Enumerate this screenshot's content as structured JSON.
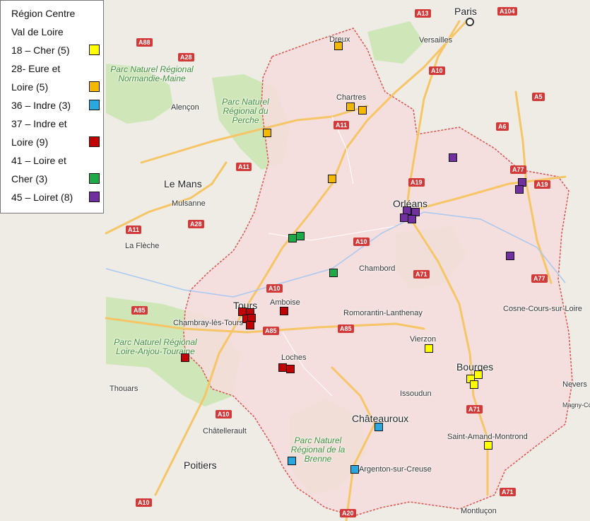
{
  "legend": {
    "title_line1": "Région Centre",
    "title_line2": "Val de Loire",
    "entries": [
      {
        "lines": [
          "18 – Cher (5)"
        ],
        "color": "#ffff00"
      },
      {
        "lines": [
          "28- Eure et",
          "Loire (5)"
        ],
        "color": "#f5b800"
      },
      {
        "lines": [
          "36 – Indre (3)"
        ],
        "color": "#29a8e0"
      },
      {
        "lines": [
          "37 – Indre et",
          "Loire (9)"
        ],
        "color": "#c00000"
      },
      {
        "lines": [
          "41 – Loire et",
          "Cher (3)"
        ],
        "color": "#1faa4a"
      },
      {
        "lines": [
          "45 – Loiret (8)"
        ],
        "color": "#7030a0"
      }
    ]
  },
  "places": {
    "paris": "Paris",
    "versailles": "Versailles",
    "dreux": "Dreux",
    "chartres": "Chartres",
    "alencon": "Alençon",
    "le_mans": "Le Mans",
    "mulsanne": "Mulsanne",
    "la_fleche": "La Flèche",
    "orleans": "Orléans",
    "chambord": "Chambord",
    "tours": "Tours",
    "amboise": "Amboise",
    "chambray": "Chambray-lès-Tours",
    "romorantin": "Romorantin-Lanthenay",
    "vierzon": "Vierzon",
    "bourges": "Bourges",
    "issoudun": "Issoudun",
    "loches": "Loches",
    "thouars": "Thouars",
    "chatellerault": "Châtellerault",
    "chateauroux": "Châteauroux",
    "poitiers": "Poitiers",
    "argenton": "Argenton-sur-Creuse",
    "saint_amand": "Saint-Amand-Montrond",
    "cosne": "Cosne-Cours-sur-Loire",
    "nevers": "Nevers",
    "magny": "Magny-Cour",
    "montlucon": "Montluçon"
  },
  "parks": {
    "normandie_maine": "Parc Naturel Régional Normandie-Maine",
    "perche": "Parc Naturel Régional du Perche",
    "loire_anjou": "Parc Naturel Régional Loire-Anjou-Touraine",
    "brenne": "Parc Naturel Régional de la Brenne"
  },
  "roads": [
    "A13",
    "A104",
    "A88",
    "A28",
    "A10",
    "A11",
    "A19",
    "A5",
    "A6",
    "A77",
    "A85",
    "A71",
    "A20"
  ],
  "markers": {
    "cher": {
      "color": "#ffff00",
      "count": 5
    },
    "eure_et_loir": {
      "color": "#f5b800",
      "count": 5
    },
    "indre": {
      "color": "#29a8e0",
      "count": 3
    },
    "indre_et_loire": {
      "color": "#c00000",
      "count": 9
    },
    "loir_et_cher": {
      "color": "#1faa4a",
      "count": 3
    },
    "loiret": {
      "color": "#7030a0",
      "count": 8
    }
  },
  "colors": {
    "region_fill": "#f6dcdc",
    "region_border": "#d9534f",
    "park_green": "#cfe6b8",
    "road_orange": "#f6c566",
    "background": "#efece6"
  }
}
